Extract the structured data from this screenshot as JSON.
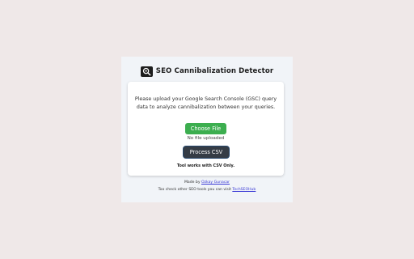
{
  "app": {
    "title": "SEO Cannibalization Detector",
    "logo_icon": "magnifier-search-icon"
  },
  "upload": {
    "description": "Please upload your Google Search Console (GSC) query data to analyze cannibalization between your queries.",
    "choose_label": "Choose File",
    "status": "No file uploaded",
    "process_label": "Process CSV",
    "note": "Tool works with CSV Only."
  },
  "footer": {
    "made_by_prefix": "Made by ",
    "author": "Ozkay Gunacar",
    "other_tools_prefix": "Too check other SEO tools you can visit ",
    "site": "TechSEOHub"
  },
  "colors": {
    "background": "#efe8e8",
    "panel": "#f1f4f8",
    "choose_button": "#3cae4f",
    "process_button": "#353c45",
    "link": "#3a3ad6"
  }
}
